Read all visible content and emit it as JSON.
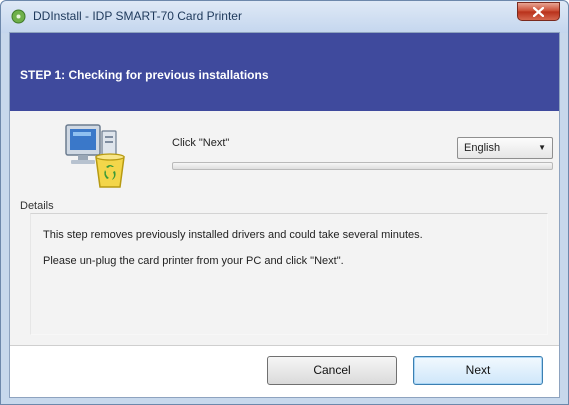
{
  "window": {
    "title": "DDInstall  -  IDP SMART-70 Card Printer",
    "icons": {
      "app": "installer-disc-icon",
      "close": "close-icon"
    }
  },
  "header": {
    "step_title": "STEP 1: Checking for previous installations"
  },
  "main": {
    "instruction": "Click \"Next\"",
    "language": {
      "selected": "English",
      "icon": "chevron-down-icon"
    },
    "progress": {
      "value": 0
    },
    "install_icon": "computer-recycle-icon"
  },
  "details": {
    "label": "Details",
    "lines": [
      "This step removes previously installed drivers and could take several minutes.",
      "Please un-plug the card printer from your PC and click \"Next\"."
    ]
  },
  "buttons": {
    "cancel": "Cancel",
    "next": "Next"
  },
  "colors": {
    "header_band": "#3f4a9d",
    "progress_fill": "#37b637"
  }
}
